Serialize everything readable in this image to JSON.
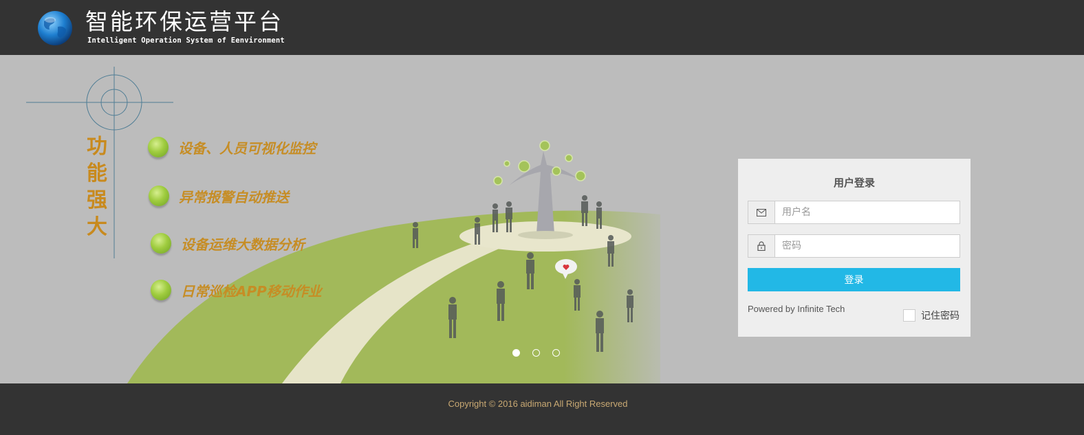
{
  "header": {
    "title": "智能环保运营平台",
    "subtitle": "Intelligent Operation System of Eenvironment",
    "logo_icon": "globe-icon"
  },
  "features": {
    "label": "功能强大",
    "items": [
      {
        "text": "设备、人员可视化监控"
      },
      {
        "text": "异常报警自动推送"
      },
      {
        "text": "设备运维大数据分析"
      },
      {
        "text": "日常巡检APP移动作业"
      }
    ]
  },
  "carousel": {
    "slides": 3,
    "active_index": 0
  },
  "login": {
    "title": "用户登录",
    "username_placeholder": "用户名",
    "username_value": "",
    "username_icon": "envelope-icon",
    "password_placeholder": "密码",
    "password_value": "",
    "password_icon": "lock-icon",
    "submit_label": "登录",
    "powered_by": "Powered by Infinite Tech",
    "remember_label": "记住密码",
    "remember_checked": false
  },
  "footer": {
    "copyright": "Copyright © 2016 aidiman All Right Reserved"
  },
  "colors": {
    "header_bg": "#333333",
    "main_bg": "#bcbcbc",
    "accent": "#22b8e6",
    "feature_text": "#c68d25",
    "lawn": "#a4bb5a"
  }
}
